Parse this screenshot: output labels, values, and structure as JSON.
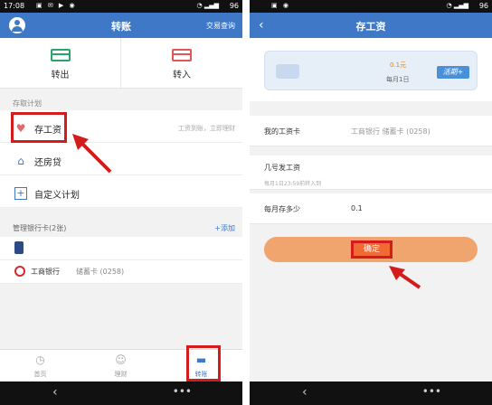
{
  "left": {
    "status": {
      "time": "17:08",
      "battery": "96"
    },
    "header": {
      "title": "转账",
      "right_link": "交易查询"
    },
    "transfer": {
      "out_label": "转出",
      "in_label": "转入"
    },
    "plan_section": "存取计划",
    "plans": [
      {
        "label": "存工资",
        "hint": "工资到账，立即理财"
      },
      {
        "label": "还房贷",
        "hint": ""
      },
      {
        "label": "自定义计划",
        "hint": ""
      }
    ],
    "bank_section": {
      "title": "管理银行卡(2张)",
      "add": "+添加"
    },
    "banks": [
      {
        "name": "工商银行",
        "type": "储蓄卡 (0258)"
      }
    ],
    "tabs": [
      {
        "label": "首页"
      },
      {
        "label": "理财"
      },
      {
        "label": "转账"
      }
    ]
  },
  "right": {
    "status": {
      "battery": "96"
    },
    "header": {
      "title": "存工资"
    },
    "card": {
      "amount": "0.1元",
      "date": "每月1日",
      "tag": "活期+"
    },
    "fields": {
      "salary_card_label": "我的工资卡",
      "salary_card_value": "工商银行 储蓄卡 (0258)",
      "payday_label": "几号发工资",
      "payday_note": "每月1日23:59前转入到",
      "monthly_label": "每月存多少",
      "monthly_value": "0.1"
    },
    "confirm_label": "确定"
  },
  "colors": {
    "header": "#3f78c6",
    "accent_red": "#d41c1c",
    "confirm": "#f26a33"
  }
}
